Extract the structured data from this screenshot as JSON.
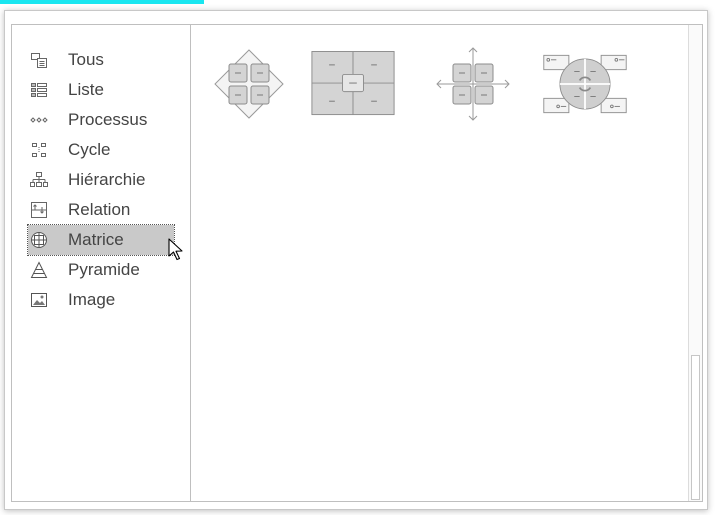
{
  "categories": [
    {
      "label": "Tous",
      "icon": "all-icon"
    },
    {
      "label": "Liste",
      "icon": "list-icon"
    },
    {
      "label": "Processus",
      "icon": "process-icon"
    },
    {
      "label": "Cycle",
      "icon": "cycle-icon"
    },
    {
      "label": "Hiérarchie",
      "icon": "hierarchy-icon"
    },
    {
      "label": "Relation",
      "icon": "relationship-icon"
    },
    {
      "label": "Matrice",
      "icon": "matrix-icon"
    },
    {
      "label": "Pyramide",
      "icon": "pyramid-icon"
    },
    {
      "label": "Image",
      "icon": "picture-icon"
    }
  ],
  "selected_category": "Matrice",
  "layouts": [
    {
      "icon": "basic-matrix-icon"
    },
    {
      "icon": "titled-matrix-icon"
    },
    {
      "icon": "grid-matrix-icon"
    },
    {
      "icon": "cycle-matrix-icon"
    }
  ],
  "colors": {
    "accent": "#19e6f0",
    "selection": "#c9c9c9",
    "shape_fill": "#d4d4d4",
    "shape_stroke": "#8c8c8c"
  }
}
